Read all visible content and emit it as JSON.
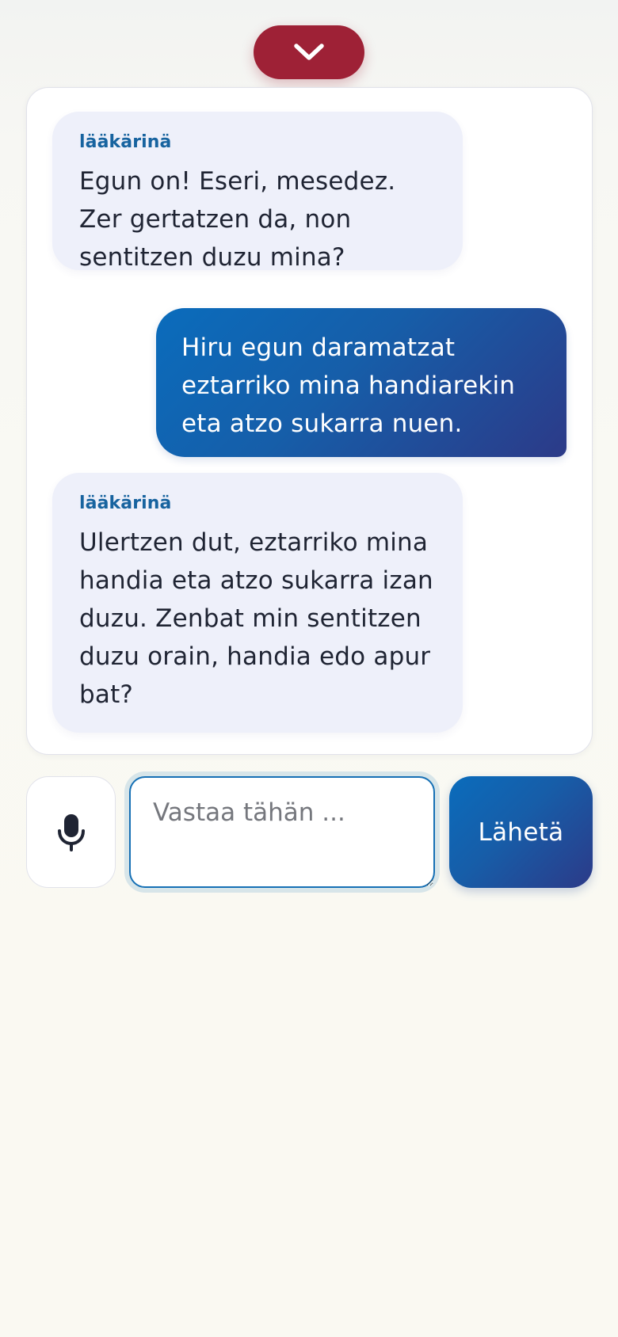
{
  "header": {
    "collapse_icon": "chevron-down-icon"
  },
  "chat": {
    "messages": [
      {
        "role": "assistant",
        "sender": "lääkärinä",
        "text": "Egun on! Eseri, mesedez. Zer gertatzen da, non sentitzen duzu mina?"
      },
      {
        "role": "user",
        "text": "Hiru egun daramatzat eztarriko mina handiarekin eta atzo sukarra nuen."
      },
      {
        "role": "assistant",
        "sender": "lääkärinä",
        "text": "Ulertzen dut, eztarriko mina handia eta atzo sukarra izan duzu. Zenbat min sentitzen duzu orain, handia edo apur bat?"
      }
    ]
  },
  "composer": {
    "mic_icon": "microphone-icon",
    "input_value": "",
    "placeholder": "Vastaa tähän ...",
    "send_label": "Lähetä"
  },
  "colors": {
    "collapse_button": "#9e2136",
    "accent_blue": "#0a6cbc",
    "accent_indigo": "#2c3a88",
    "assistant_bubble": "#eef0fa",
    "sender_label": "#17639f",
    "text_dark": "#1f2433"
  }
}
